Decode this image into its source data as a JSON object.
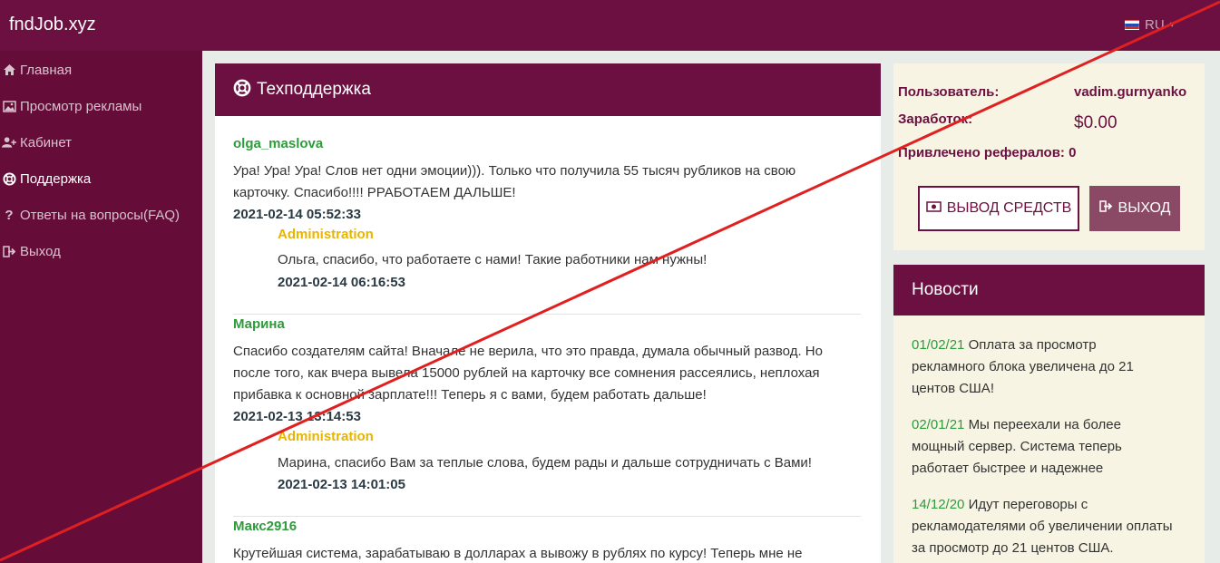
{
  "header": {
    "brand": "fndJob.xyz",
    "lang": "RU"
  },
  "sidebar": {
    "items": [
      {
        "label": "Главная"
      },
      {
        "label": "Просмотр рекламы"
      },
      {
        "label": "Кабинет"
      },
      {
        "label": "Поддержка"
      },
      {
        "label": "Ответы на вопросы(FAQ)"
      },
      {
        "label": "Выход"
      }
    ]
  },
  "support": {
    "title": "Техподдержка",
    "posts": [
      {
        "author": "olga_maslova",
        "lines": [
          "Ура! Ура! Ура! Слов нет одни эмоции))). Только что получила 55 тысяч рубликов на свою",
          "карточку. Спасибо!!!! РРАБОТАЕМ ДАЛЬШЕ!"
        ],
        "date": "2021-02-14 05:52:33",
        "reply": {
          "name": "Administration",
          "text": "Ольга, спасибо, что работаете с нами! Такие работники нам нужны!",
          "date": "2021-02-14 06:16:53"
        }
      },
      {
        "author": "Марина",
        "lines": [
          "Спасибо создателям сайта! Вначале не верила, что это правда, думала обычный развод. Но",
          "после того, как вчера вывела 15000 рублей на карточку все сомнения рассеялись, неплохая",
          "прибавка к основной зарплате!!! Теперь я с вами, будем работать дальше!"
        ],
        "date": "2021-02-13 13:14:53",
        "reply": {
          "name": "Administration",
          "text": "Марина, спасибо Вам за теплые слова, будем рады и дальше сотрудничать с Вами!",
          "date": "2021-02-13 14:01:05"
        }
      },
      {
        "author": "Макс2916",
        "lines": [
          "Крутейшая система, зарабатываю в долларах а вывожу в рублях по курсу! Теперь мне не"
        ]
      }
    ]
  },
  "user": {
    "user_label": "Пользователь:",
    "user_value": "vadim.gurnyanko",
    "earn_label": "Заработок:",
    "earn_value": "$0.00",
    "ref_label": "Привлечено рефералов: 0",
    "withdraw_label": "ВЫВОД СРЕДСТВ",
    "logout_label": "ВЫХОД"
  },
  "news": {
    "title": "Новости",
    "items": [
      {
        "date": "01/02/21",
        "lines": [
          "Оплата за просмотр",
          "рекламного блока увеличена до 21",
          "центов США!"
        ]
      },
      {
        "date": "02/01/21",
        "lines": [
          "Мы переехали на более",
          "мощный сервер. Система теперь",
          "работает быстрее и надежнее"
        ]
      },
      {
        "date": "14/12/20",
        "lines": [
          "Идут переговоры с",
          "рекламодателями об увеличении оплаты",
          "за просмотр до 21 центов США."
        ]
      }
    ]
  },
  "colors": {
    "primary": "#6b1040",
    "sidebar": "#660c39",
    "green": "#2e9b3c",
    "admin": "#e8b400",
    "panel_bg": "#f7f4e3",
    "overlay_line": "#e02020"
  }
}
